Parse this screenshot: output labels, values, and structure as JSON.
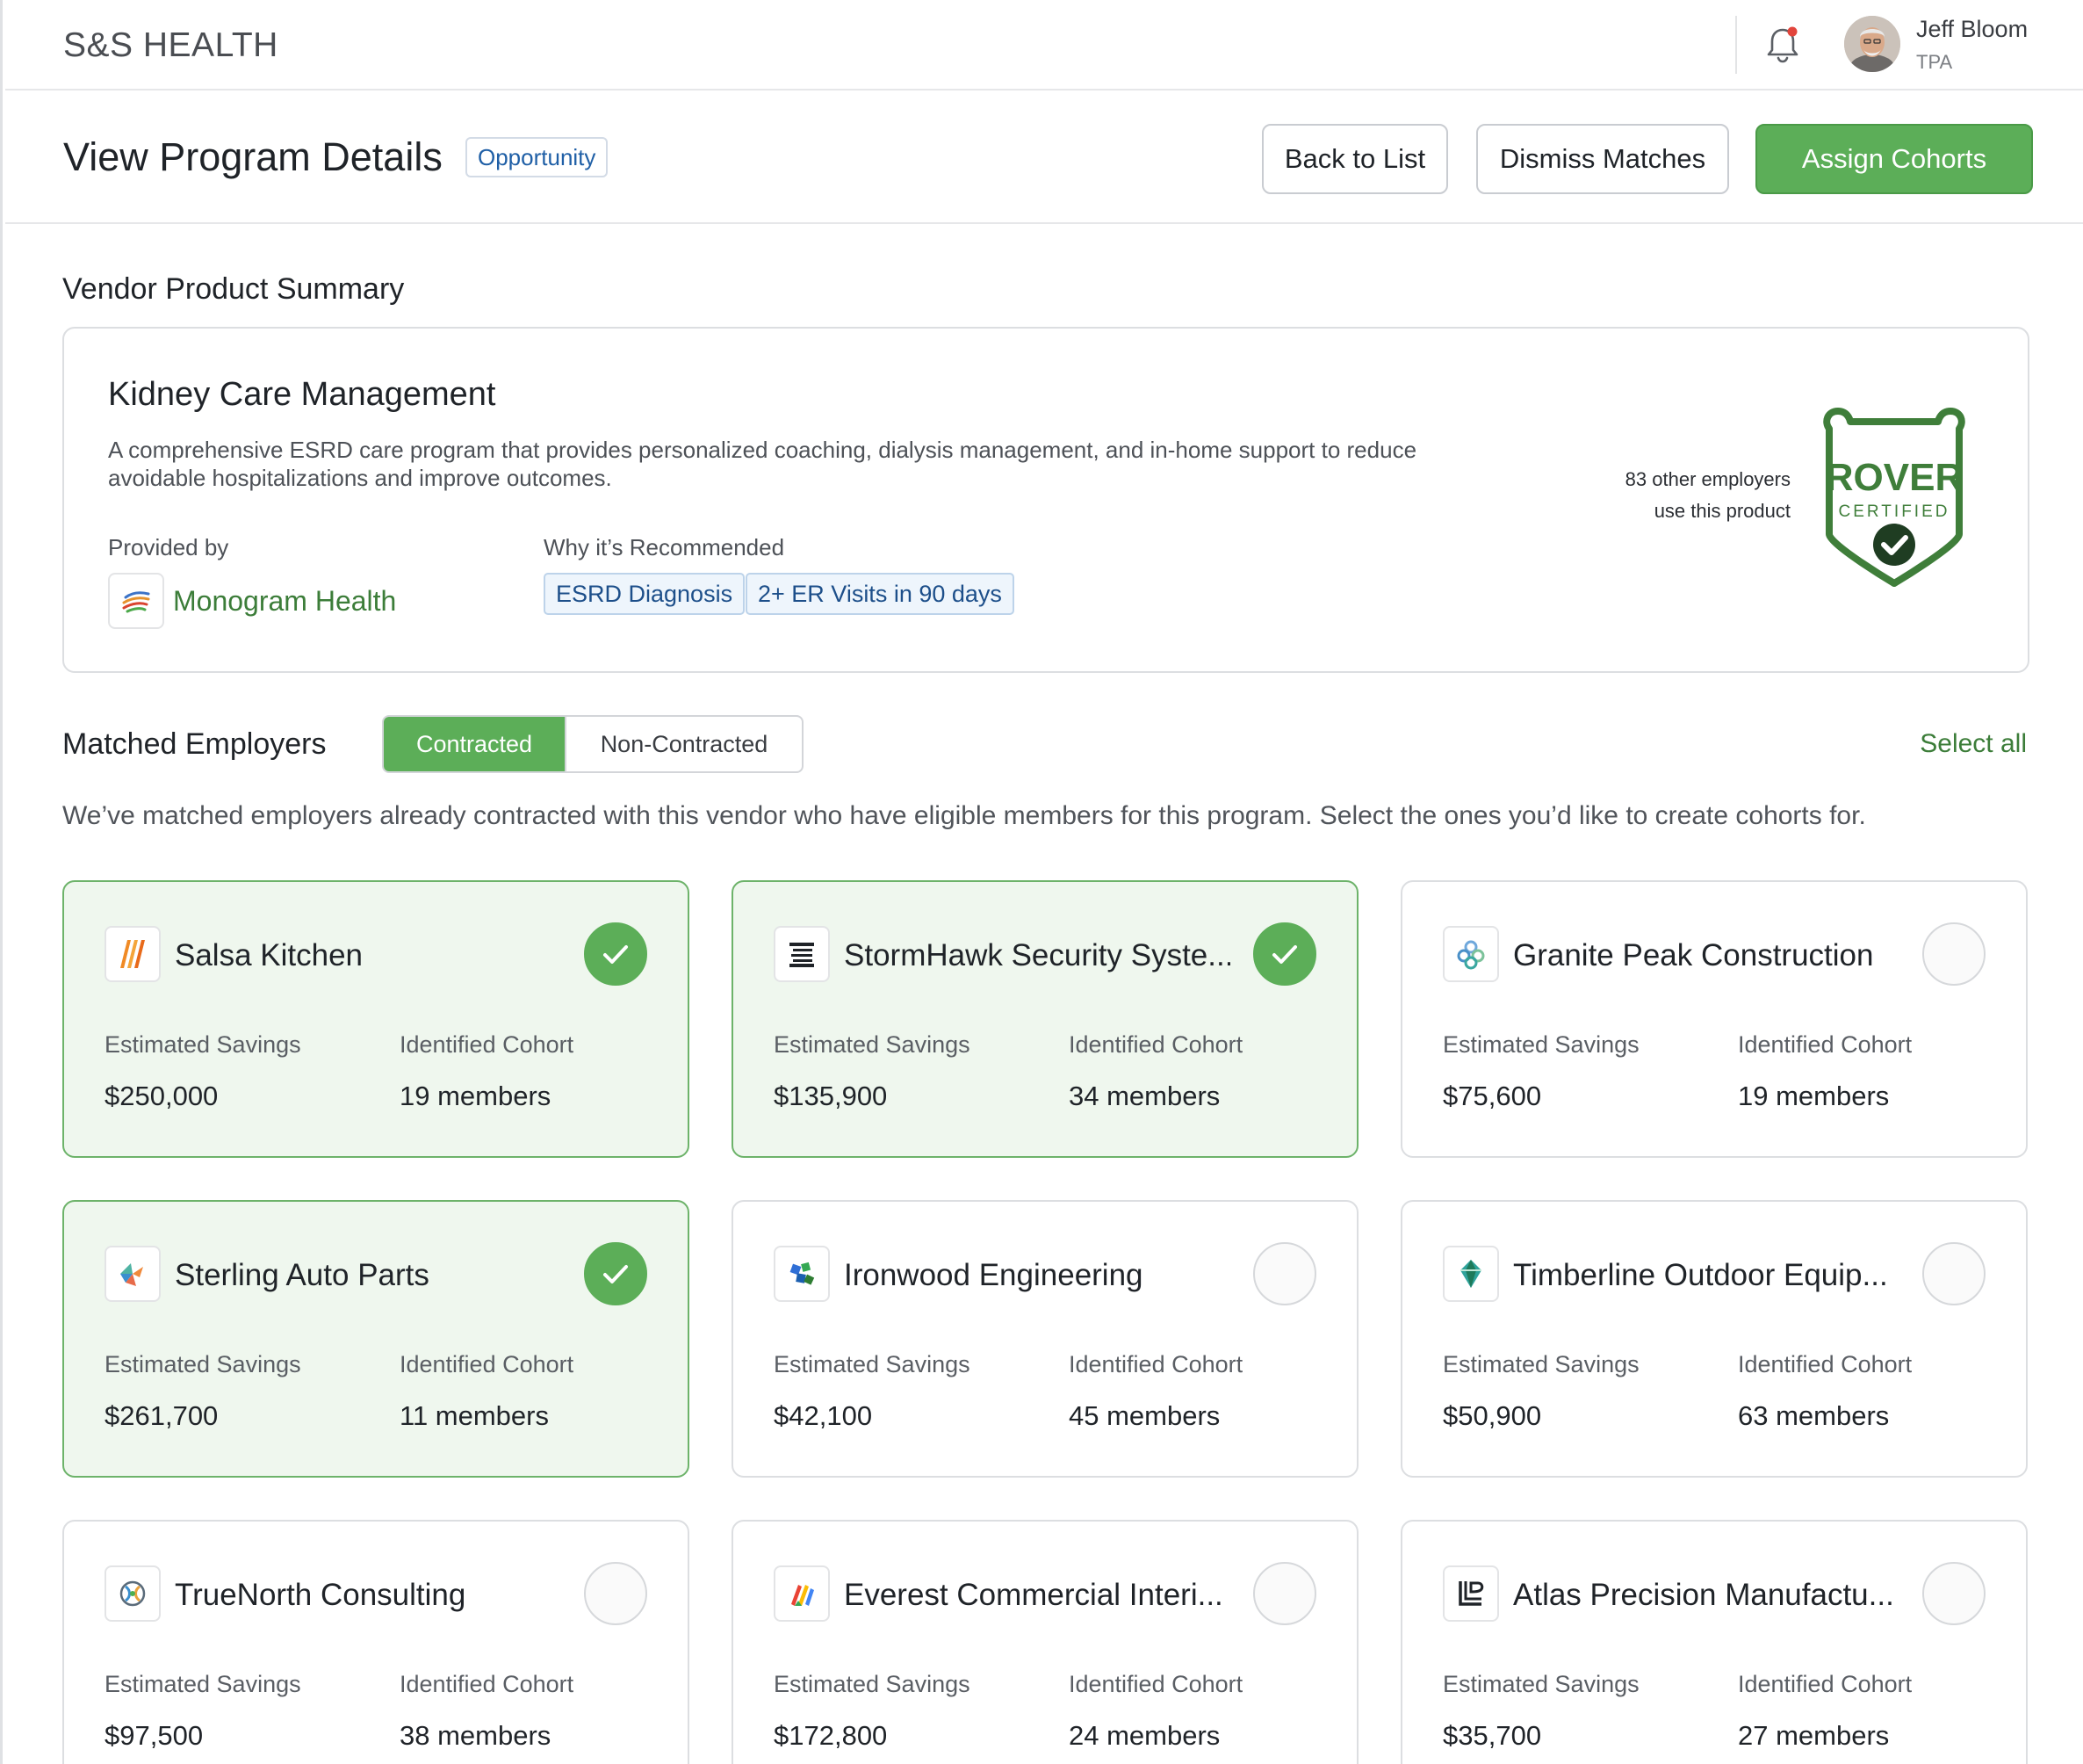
{
  "topbar": {
    "brand": "S&S HEALTH",
    "user_name": "Jeff Bloom",
    "user_role": "TPA"
  },
  "header": {
    "title": "View Program Details",
    "badge": "Opportunity",
    "back_label": "Back to List",
    "dismiss_label": "Dismiss Matches",
    "assign_label": "Assign Cohorts"
  },
  "summary": {
    "section_title": "Vendor Product Summary",
    "product_name": "Kidney Care Management",
    "description": "A comprehensive ESRD care program that provides personalized coaching, dialysis management, and in-home support to reduce avoidable hospitalizations and improve outcomes.",
    "provided_by_label": "Provided by",
    "vendor_name": "Monogram Health",
    "why_label": "Why it’s Recommended",
    "chips": [
      "ESRD Diagnosis",
      "2+ ER Visits in 90 days"
    ],
    "employers_line1": "83 other employers",
    "employers_line2": "use this product",
    "badge_word": "ROVER",
    "badge_sub": "CERTIFIED"
  },
  "matched": {
    "title": "Matched Employers",
    "tab_contracted": "Contracted",
    "tab_noncontracted": "Non-Contracted",
    "select_all": "Select all",
    "description": "We’ve matched employers already contracted with this vendor who have eligible members for this program. Select the ones you’d like to create cohorts for.",
    "savings_label": "Estimated Savings",
    "cohort_label": "Identified Cohort",
    "employers": [
      {
        "name": "Salsa Kitchen",
        "savings": "$250,000",
        "cohort": "19 members",
        "selected": true
      },
      {
        "name": "StormHawk Security Syste...",
        "savings": "$135,900",
        "cohort": "34 members",
        "selected": true
      },
      {
        "name": "Granite Peak Construction",
        "savings": "$75,600",
        "cohort": "19 members",
        "selected": false
      },
      {
        "name": "Sterling Auto Parts",
        "savings": "$261,700",
        "cohort": "11 members",
        "selected": true
      },
      {
        "name": "Ironwood Engineering",
        "savings": "$42,100",
        "cohort": "45 members",
        "selected": false
      },
      {
        "name": "Timberline Outdoor Equip...",
        "savings": "$50,900",
        "cohort": "63 members",
        "selected": false
      },
      {
        "name": "TrueNorth Consulting",
        "savings": "$97,500",
        "cohort": "38 members",
        "selected": false
      },
      {
        "name": "Everest Commercial Interi...",
        "savings": "$172,800",
        "cohort": "24 members",
        "selected": false
      },
      {
        "name": "Atlas Precision Manufactu...",
        "savings": "$35,700",
        "cohort": "27 members",
        "selected": false
      }
    ]
  },
  "colors": {
    "accent_green": "#5cae58",
    "link_green": "#3c7d39",
    "chip_blue": "#1d4f8a",
    "badge_green": "#3f7e3a"
  }
}
